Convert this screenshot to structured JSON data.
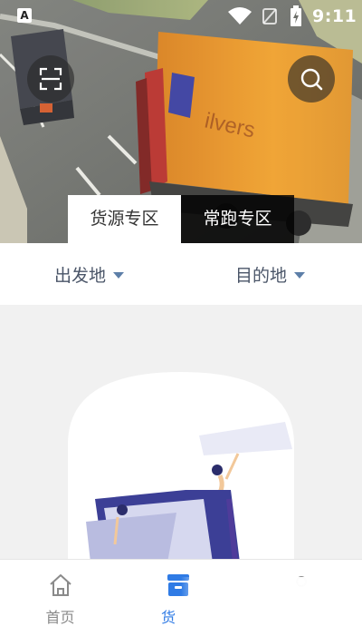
{
  "status_bar": {
    "time": "9:11",
    "notification_icon": "a-app-icon",
    "wifi_icon": "wifi-icon",
    "signal_icon": "sim-icon",
    "battery_icon": "battery-charging-icon"
  },
  "header": {
    "scan_icon": "scan-icon",
    "search_icon": "search-icon",
    "tabs": [
      {
        "label": "货源专区",
        "active": true
      },
      {
        "label": "常跑专区",
        "active": false
      }
    ]
  },
  "filters": {
    "origin_label": "出发地",
    "destination_label": "目的地"
  },
  "bottom_nav": {
    "items": [
      {
        "label": "首页",
        "icon": "home-icon",
        "active": false
      },
      {
        "label": "货",
        "icon": "box-icon",
        "active": true
      },
      {
        "label": "",
        "icon": "person-icon",
        "active": false
      }
    ]
  },
  "colors": {
    "accent": "#2f7be5",
    "filter_text": "#4a5568",
    "caret": "#5d7fa8",
    "page_bg": "#f1f1f1"
  }
}
